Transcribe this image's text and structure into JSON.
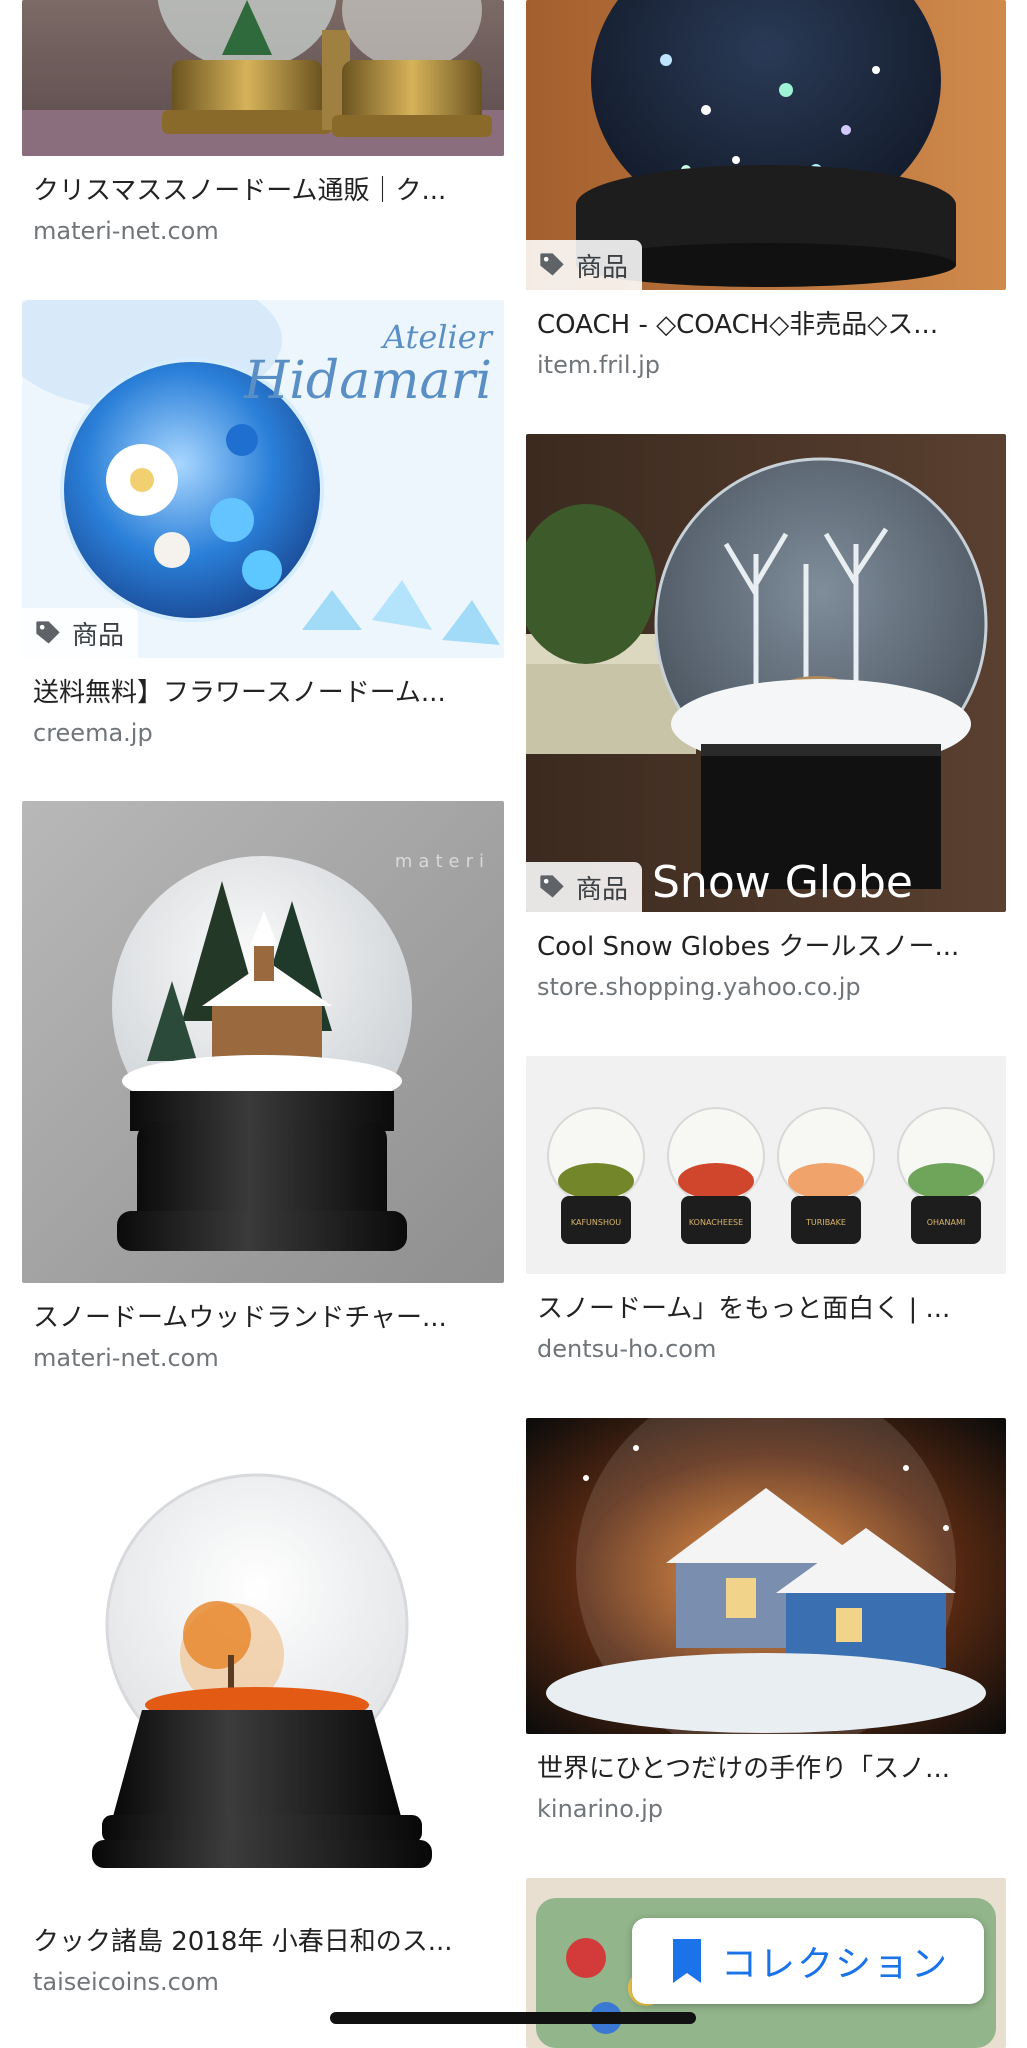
{
  "results": {
    "left": [
      {
        "title": "クリスマススノードーム通販｜ク...",
        "source": "materi-net.com"
      },
      {
        "title": "送料無料】フラワースノードーム...",
        "source": "creema.jp",
        "badge": "商品",
        "watermark_line1": "Atelier",
        "watermark_line2": "Hidamari"
      },
      {
        "title": "スノードームウッドランドチャー...",
        "source": "materi-net.com",
        "watermark": "materi"
      },
      {
        "title": "クック諸島 2018年 小春日和のス...",
        "source": "taiseicoins.com"
      }
    ],
    "right": [
      {
        "title": "COACH - ◇COACH◇非売品◇ス...",
        "source": "item.fril.jp",
        "badge": "商品"
      },
      {
        "title": "Cool Snow Globes クールスノー...",
        "source": "store.shopping.yahoo.co.jp",
        "badge": "商品",
        "overlay_text": "Snow Globe"
      },
      {
        "title": "スノードーム」をもっと面白く | ...",
        "source": "dentsu-ho.com",
        "plaques": [
          "KAFUNSHOU",
          "KONACHEESE",
          "TURIBAKE",
          "OHANAMI"
        ]
      },
      {
        "title": "世界にひとつだけの手作り「スノ...",
        "source": "kinarino.jp"
      },
      {}
    ]
  },
  "collection_button": {
    "label": "コレクション",
    "icon": "bookmark-icon"
  },
  "colors": {
    "accent": "#1a73e8",
    "title": "#222222",
    "source": "#70757a"
  }
}
